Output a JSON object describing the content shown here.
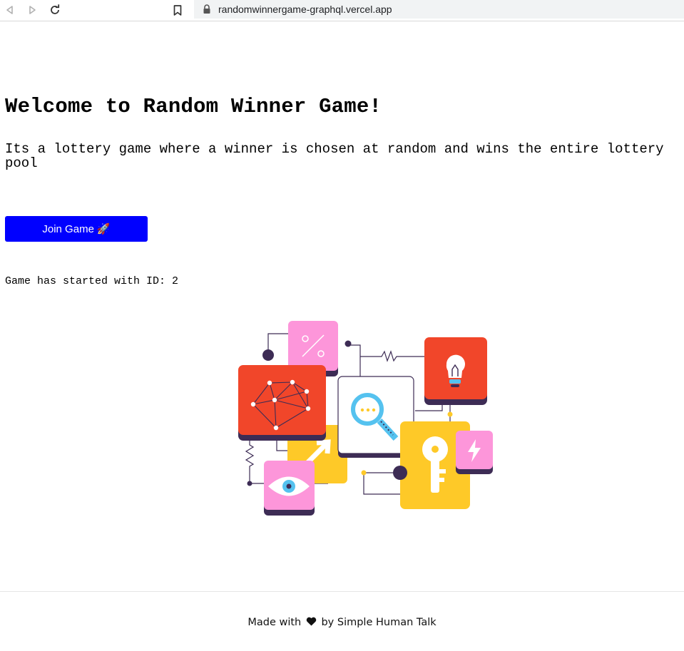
{
  "browser": {
    "url": "randomwinnergame-graphql.vercel.app",
    "back_icon": "back-arrow-icon",
    "forward_icon": "forward-arrow-icon",
    "reload_icon": "reload-icon",
    "bookmark_icon": "bookmark-icon",
    "lock_icon": "lock-icon"
  },
  "main": {
    "title": "Welcome to Random Winner Game!",
    "description": "Its a lottery game where a winner is chosen at random and wins the entire lottery pool",
    "join_button_label": "Join Game",
    "join_button_emoji": "🚀",
    "status_text": "Game has started with ID: 2"
  },
  "footer": {
    "prefix": "Made with",
    "heart_icon": "heart-icon",
    "suffix": "by Simple Human Talk"
  },
  "colors": {
    "join_button_bg": "#0000ff",
    "illustration_red": "#f1462a",
    "illustration_yellow": "#fec928",
    "illustration_pink": "#fd96da",
    "illustration_navy": "#3d2c55",
    "illustration_blue": "#55c2ef"
  }
}
